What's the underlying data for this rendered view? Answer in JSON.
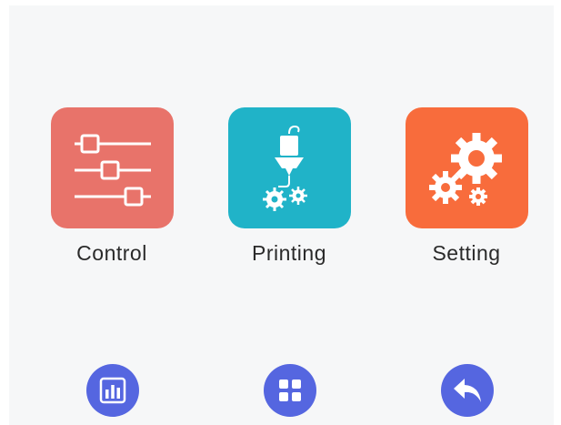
{
  "menu": {
    "items": [
      {
        "label": "Control",
        "icon": "sliders-icon",
        "color": "#e8736a"
      },
      {
        "label": "Printing",
        "icon": "printer-extruder-icon",
        "color": "#20b3c8"
      },
      {
        "label": "Setting",
        "icon": "gears-icon",
        "color": "#f86c3c"
      }
    ]
  },
  "nav": {
    "color": "#5566e0",
    "buttons": [
      {
        "icon": "bar-chart-icon"
      },
      {
        "icon": "grid-icon"
      },
      {
        "icon": "back-arrow-icon"
      }
    ]
  }
}
